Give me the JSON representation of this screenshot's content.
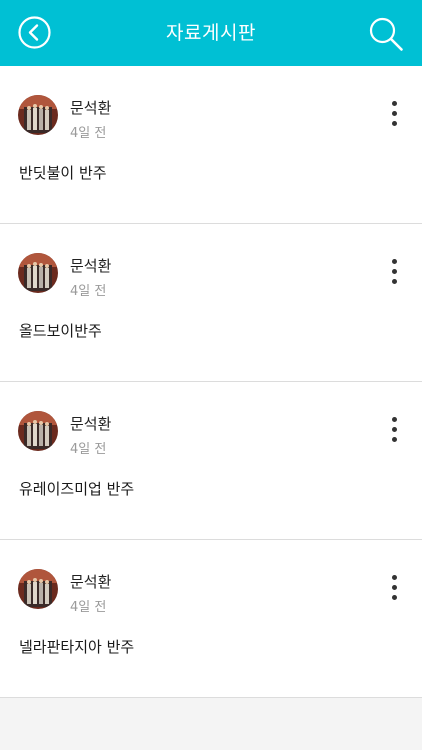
{
  "header": {
    "title": "자료게시판",
    "back_icon": "back-arrow-circle-icon",
    "search_icon": "search-icon",
    "background_color": "#00c0d4"
  },
  "posts": [
    {
      "author": "문석환",
      "time": "4일 전",
      "title": "반딧불이 반주"
    },
    {
      "author": "문석환",
      "time": "4일 전",
      "title": "올드보이반주"
    },
    {
      "author": "문석환",
      "time": "4일 전",
      "title": "유레이즈미업 반주"
    },
    {
      "author": "문석환",
      "time": "4일 전",
      "title": "넬라판타지아 반주"
    }
  ],
  "icons": {
    "avatar": "user-avatar-photo",
    "more": "more-vertical-icon"
  }
}
